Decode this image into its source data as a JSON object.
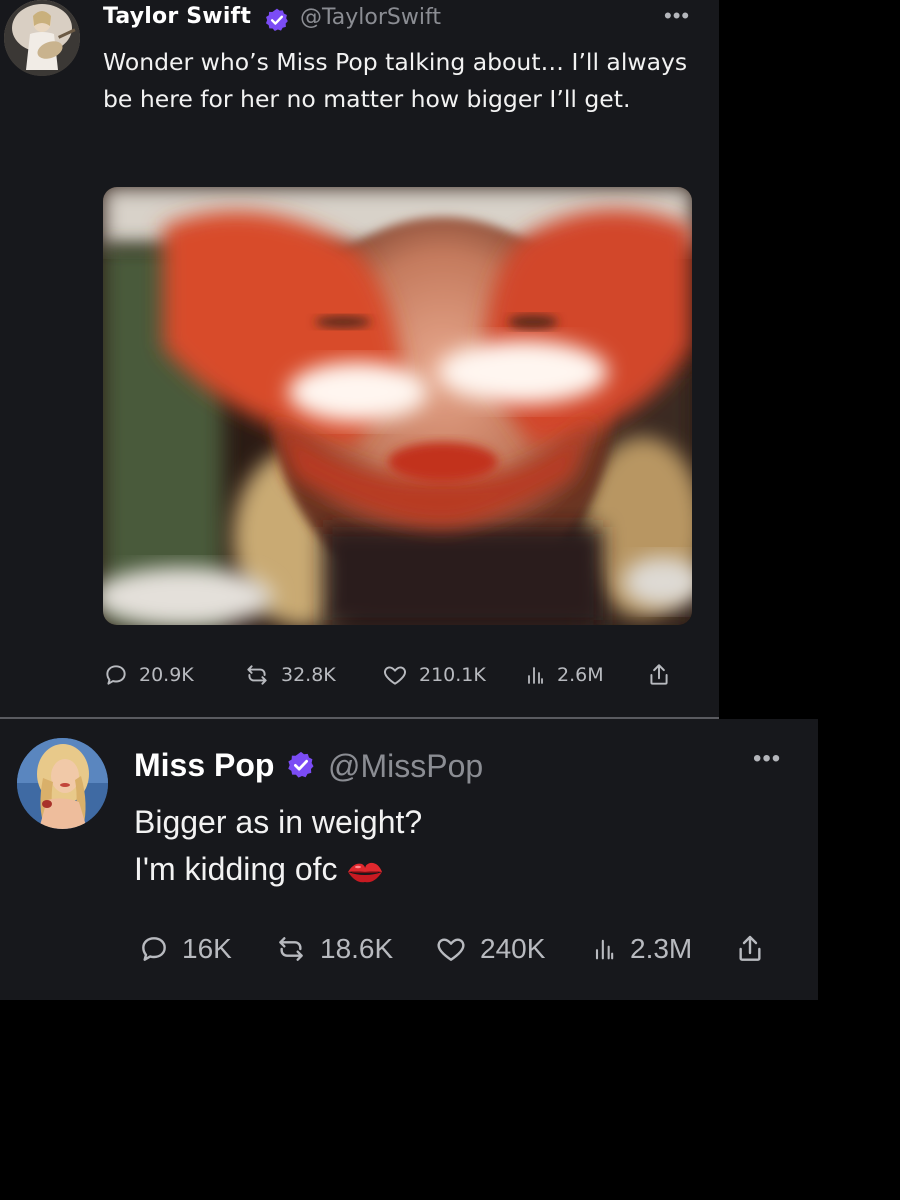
{
  "tweet_1": {
    "author": {
      "name": "Taylor Swift",
      "handle": "@TaylorSwift",
      "verified_color": "#7b4cf5",
      "avatar_icon": "performer-with-guitar-avatar"
    },
    "more_icon": "more-options-icon",
    "text": "Wonder who’s Miss Pop talking about… I’ll always be here for her no matter how bigger I’ll get.",
    "media_icon": "hand-heart-photo",
    "stats": {
      "replies": "20.9K",
      "retweets": "32.8K",
      "likes": "210.1K",
      "views": "2.6M"
    }
  },
  "tweet_2": {
    "author": {
      "name": "Miss Pop",
      "handle": "@MissPop",
      "verified_color": "#7b4cf5",
      "avatar_icon": "blonde-woman-avatar"
    },
    "more_icon": "more-options-icon",
    "text_line_1": "Bigger as in weight?",
    "text_line_2": "I'm kidding ofc",
    "emoji_icon": "kiss-mark-icon",
    "stats": {
      "replies": "16K",
      "retweets": "18.6K",
      "likes": "240K",
      "views": "2.3M"
    }
  },
  "colors": {
    "card_background": "#17181c",
    "page_background": "#000000",
    "name_text": "#ffffff",
    "handle_text": "#8b8d93",
    "stat_text": "#b8babf",
    "verified_badge": "#7b4cf5"
  }
}
